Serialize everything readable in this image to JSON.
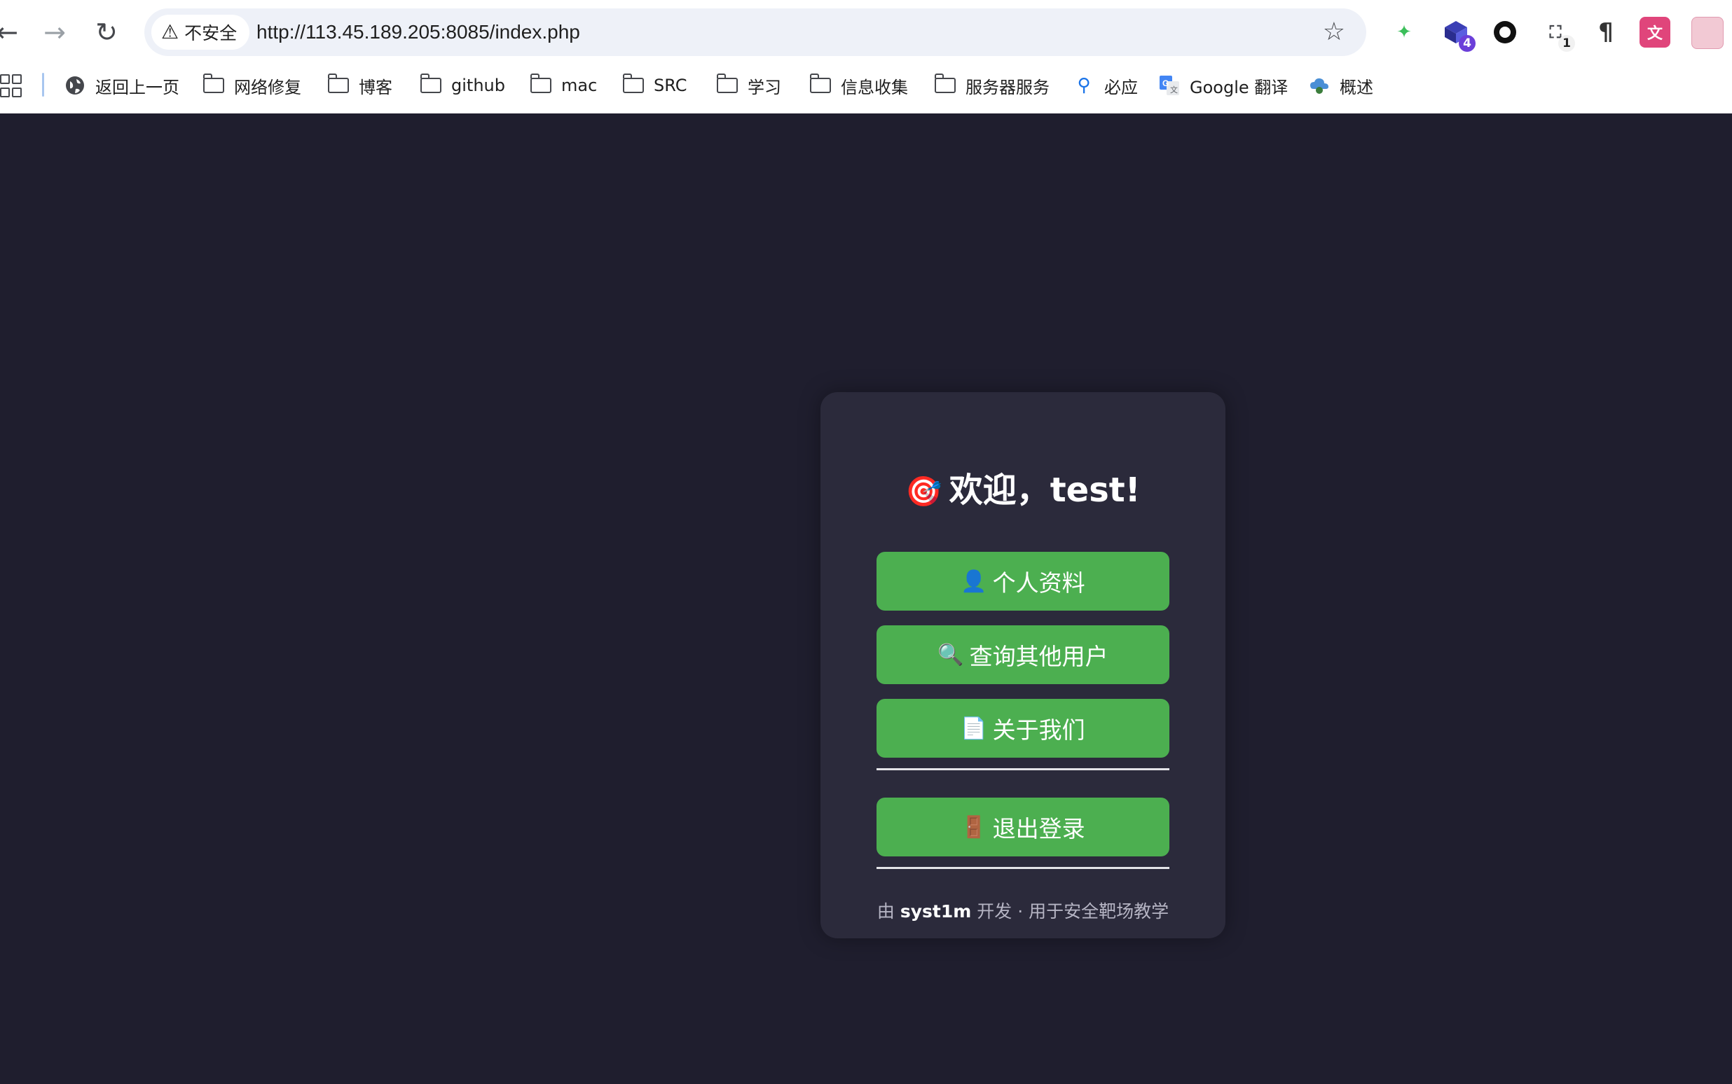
{
  "browser": {
    "security_label": "不安全",
    "url": "http://113.45.189.205:8085/index.php",
    "extensions": [
      {
        "name": "leaf-extension",
        "badge": ""
      },
      {
        "name": "cube-extension",
        "badge": "4"
      },
      {
        "name": "circle-extension",
        "badge": ""
      },
      {
        "name": "scan-extension",
        "badge": "1"
      },
      {
        "name": "paragraph-extension",
        "badge": ""
      },
      {
        "name": "translate-extension",
        "badge": ""
      }
    ]
  },
  "bookmarks": {
    "items": [
      {
        "label": "返回上一页",
        "icon": "globe-icon"
      },
      {
        "label": "网络修复",
        "icon": "folder-icon"
      },
      {
        "label": "博客",
        "icon": "folder-icon"
      },
      {
        "label": "github",
        "icon": "folder-icon"
      },
      {
        "label": "mac",
        "icon": "folder-icon"
      },
      {
        "label": "SRC",
        "icon": "folder-icon"
      },
      {
        "label": "学习",
        "icon": "folder-icon"
      },
      {
        "label": "信息收集",
        "icon": "folder-icon"
      },
      {
        "label": "服务器服务",
        "icon": "folder-icon"
      },
      {
        "label": "必应",
        "icon": "search-icon"
      },
      {
        "label": "Google 翻译",
        "icon": "google-translate-icon"
      },
      {
        "label": "概述",
        "icon": "cloud-icon"
      }
    ]
  },
  "card": {
    "title_emoji": "🎯",
    "title": "欢迎，test!",
    "buttons": [
      {
        "emoji": "👤",
        "label": "个人资料"
      },
      {
        "emoji": "🔍",
        "label": "查询其他用户"
      },
      {
        "emoji": "📄",
        "label": "关于我们"
      },
      {
        "emoji": "🚪",
        "label": "退出登录"
      }
    ],
    "footer": {
      "prefix": "由",
      "author": "syst1m",
      "suffix": "开发 · 用于安全靶场教学"
    }
  },
  "colors": {
    "page_background": "#1f1e2e",
    "card_background": "#2b2a3b",
    "button_green": "#4caf50"
  }
}
